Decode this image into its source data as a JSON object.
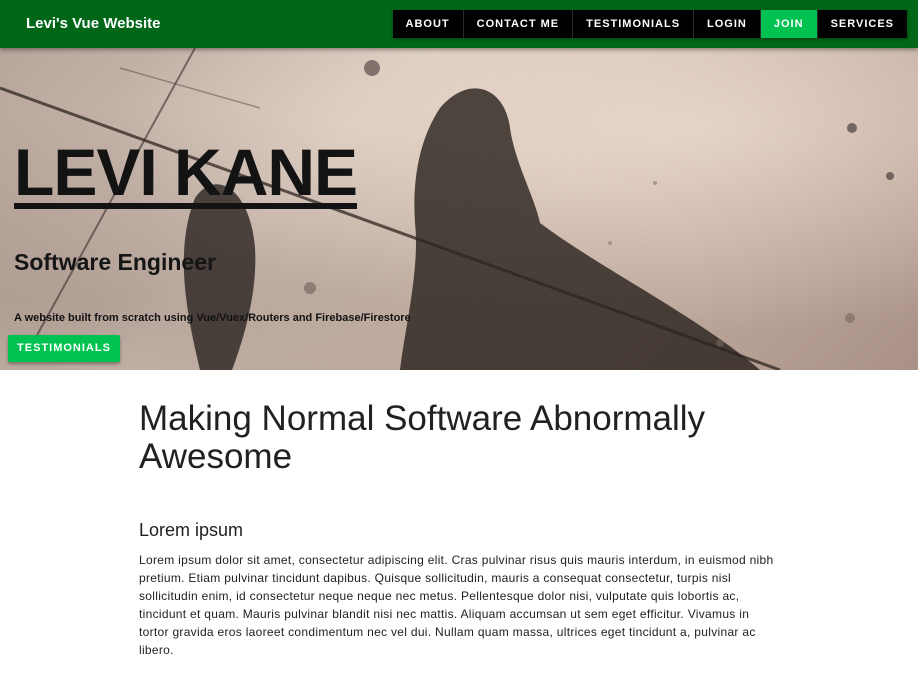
{
  "header": {
    "brand": "Levi's Vue Website",
    "nav": [
      {
        "label": "ABOUT"
      },
      {
        "label": "CONTACT ME"
      },
      {
        "label": "TESTIMONIALS"
      },
      {
        "label": "LOGIN"
      },
      {
        "label": "JOIN"
      },
      {
        "label": "SERVICES"
      }
    ]
  },
  "hero": {
    "title": "LEVI KANE",
    "subtitle": "Software Engineer",
    "description": "A website built from scratch using Vue/Vuex/Routers and Firebase/Firestore",
    "button_label": "TESTIMONIALS"
  },
  "main": {
    "headline": "Making Normal Software Abnormally Awesome",
    "section_title": "Lorem ipsum",
    "body": "Lorem ipsum dolor sit amet, consectetur adipiscing elit. Cras pulvinar risus quis mauris interdum, in euismod nibh pretium. Etiam pulvinar tincidunt dapibus. Quisque sollicitudin, mauris a consequat consectetur, turpis nisl sollicitudin enim, id consectetur neque neque nec metus. Pellentesque dolor nisi, vulputate quis lobortis ac, tincidunt et quam. Mauris pulvinar blandit nisi nec mattis. Aliquam accumsan ut sem eget efficitur. Vivamus in tortor gravida eros laoreet condimentum nec vel dui. Nullam quam massa, ultrices eget tincidunt a, pulvinar ac libero."
  },
  "colors": {
    "appbar": "#006618",
    "accent": "#00c251",
    "nav_bg": "#000000"
  }
}
